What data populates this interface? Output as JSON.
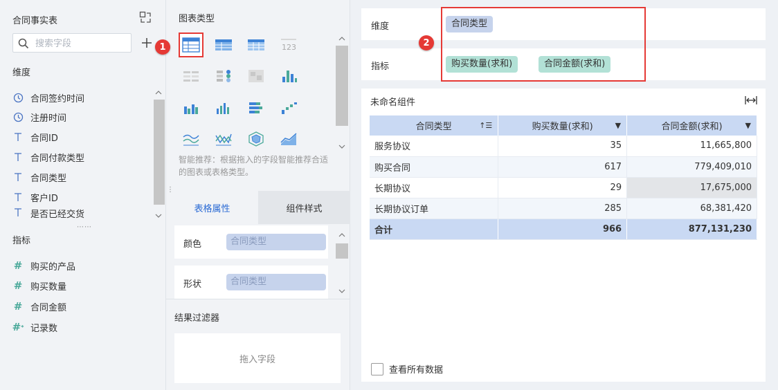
{
  "left": {
    "dataset_title": "合同事实表",
    "search_placeholder": "搜索字段",
    "dimension_label": "维度",
    "dimensions": [
      {
        "label": "合同签约时间",
        "icon": "clock-icon"
      },
      {
        "label": "注册时间",
        "icon": "clock-icon"
      },
      {
        "label": "合同ID",
        "icon": "text-type-icon"
      },
      {
        "label": "合同付款类型",
        "icon": "text-type-icon"
      },
      {
        "label": "合同类型",
        "icon": "text-type-icon"
      },
      {
        "label": "客户ID",
        "icon": "text-type-icon"
      },
      {
        "label": "是否已经交货",
        "icon": "text-type-icon"
      }
    ],
    "measure_label": "指标",
    "measures": [
      {
        "label": "购买的产品",
        "icon": "hash-icon"
      },
      {
        "label": "购买数量",
        "icon": "hash-icon"
      },
      {
        "label": "合同金额",
        "icon": "hash-icon"
      },
      {
        "label": "记录数",
        "icon": "hash-star-icon"
      }
    ]
  },
  "middle": {
    "title": "图表类型",
    "smart_tip": "智能推荐：根据拖入的字段智能推荐合适的图表或表格类型。",
    "tab_table_props": "表格属性",
    "tab_component_style": "组件样式",
    "color_label": "颜色",
    "color_value": "合同类型",
    "shape_label": "形状",
    "shape_value": "合同类型",
    "filter_title": "结果过滤器",
    "filter_placeholder": "拖入字段"
  },
  "right": {
    "dimension_shelf_label": "维度",
    "dimension_chip": "合同类型",
    "measure_shelf_label": "指标",
    "measure_chips": [
      "购买数量(求和)",
      "合同金额(求和)"
    ],
    "widget_title": "未命名组件",
    "table": {
      "headers": [
        "合同类型",
        "购买数量(求和)",
        "合同金额(求和)"
      ],
      "rows": [
        [
          "服务协议",
          "35",
          "11,665,800"
        ],
        [
          "购买合同",
          "617",
          "779,409,010"
        ],
        [
          "长期协议",
          "29",
          "17,675,000"
        ],
        [
          "长期协议订单",
          "285",
          "68,381,420"
        ]
      ],
      "total": [
        "合计",
        "966",
        "877,131,230"
      ]
    },
    "view_all_label": "查看所有数据"
  },
  "annotations": {
    "badge1": "1",
    "badge2": "2"
  },
  "colors": {
    "accent": "#2a6ad4",
    "dimension_chip": "#c6d3ec",
    "measure_chip": "#b2e1d6",
    "highlight_red": "#e53935",
    "header_blue": "#c9d9f3"
  }
}
